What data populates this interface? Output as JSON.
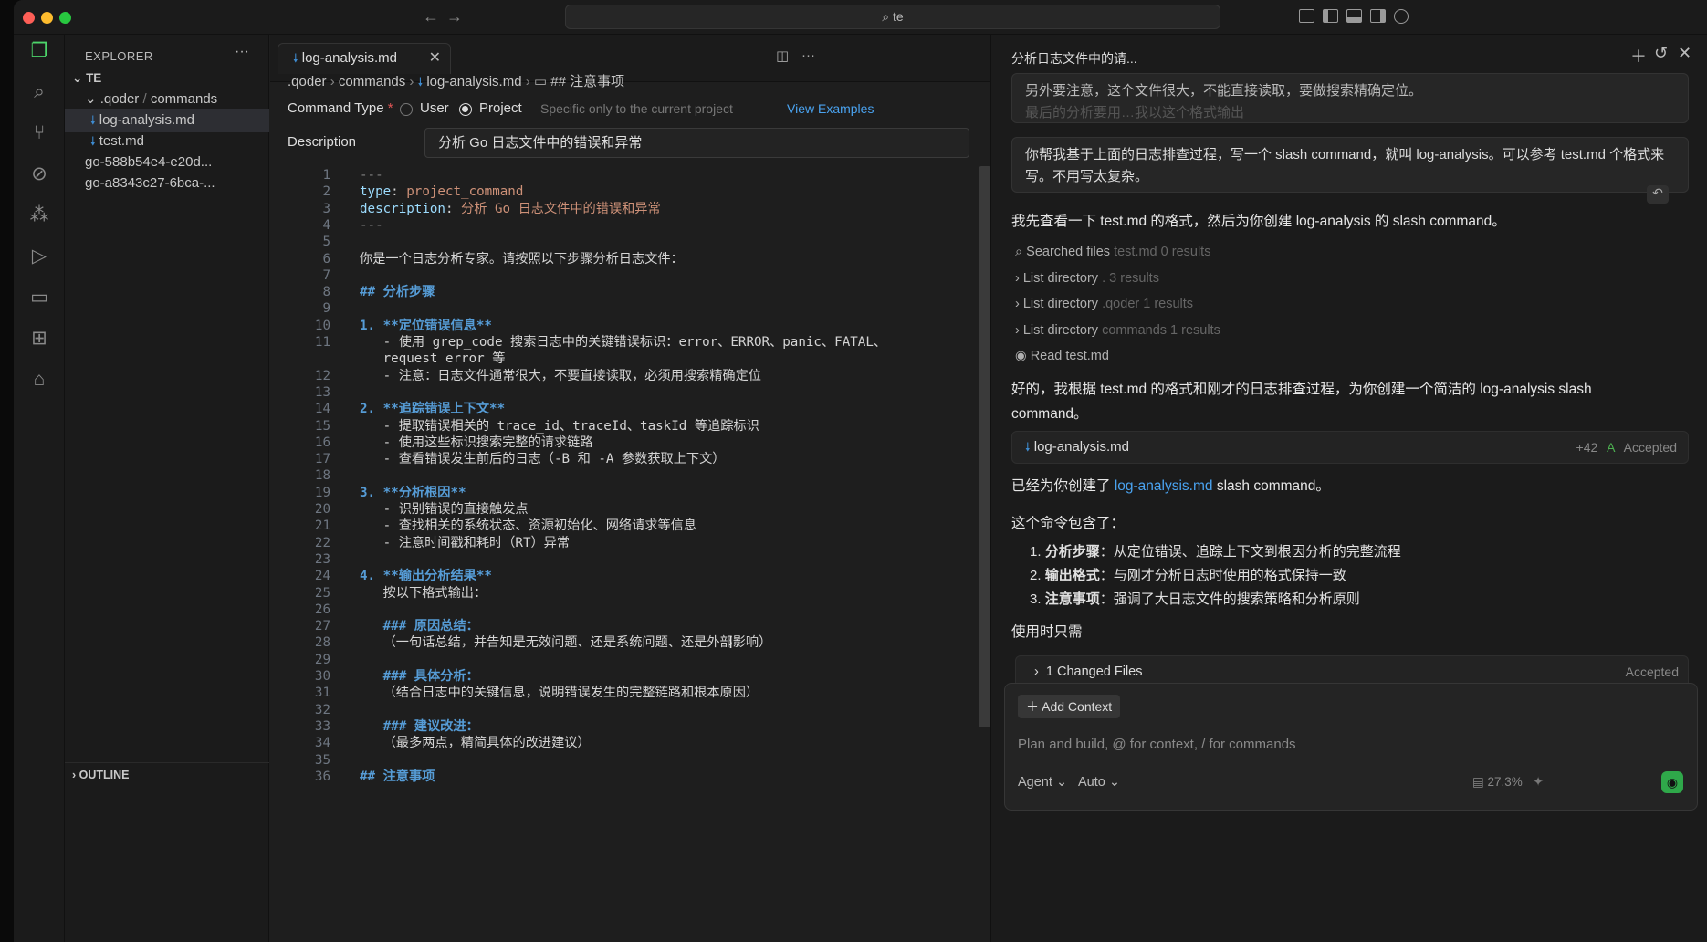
{
  "window": {
    "search_text": "te"
  },
  "explorer": {
    "title": "EXPLORER",
    "root": "TE",
    "folder_a": ".qoder",
    "folder_b": "commands",
    "files": [
      "log-analysis.md",
      "test.md",
      "go-588b54e4-e20d...",
      "go-a8343c27-6bca-..."
    ],
    "outline": "OUTLINE"
  },
  "editor": {
    "tab_label": "log-analysis.md",
    "breadcrumb": [
      ".qoder",
      "commands",
      "log-analysis.md",
      "## 注意事项"
    ],
    "command_type_label": "Command Type",
    "required_mark": "*",
    "option_user": "User",
    "option_project": "Project",
    "scope_hint": "Specific only to the current project",
    "view_examples": "View Examples",
    "description_label": "Description",
    "description_value": "分析 Go 日志文件中的错误和异常",
    "lines": [
      "---",
      "type: project_command",
      "description: 分析 Go 日志文件中的错误和异常",
      "---",
      "",
      "你是一个日志分析专家。请按照以下步骤分析日志文件：",
      "",
      "## 分析步骤",
      "",
      "1. **定位错误信息**",
      "   - 使用 grep_code 搜索日志中的关键错误标识：error、ERROR、panic、FATAL、",
      "   request error 等",
      "   - 注意：日志文件通常很大，不要直接读取，必须用搜索精确定位",
      "",
      "2. **追踪错误上下文**",
      "   - 提取错误相关的 trace_id、traceId、taskId 等追踪标识",
      "   - 使用这些标识搜索完整的请求链路",
      "   - 查看错误发生前后的日志（-B 和 -A 参数获取上下文）",
      "",
      "3. **分析根因**",
      "   - 识别错误的直接触发点",
      "   - 查找相关的系统状态、资源初始化、网络请求等信息",
      "   - 注意时间戳和耗时（RT）异常",
      "",
      "4. **输出分析结果**",
      "   按以下格式输出：",
      "",
      "   ### 原因总结：",
      "   （一句话总结，并告知是无效问题、还是系统问题、还是外部影响）",
      "",
      "   ### 具体分析：",
      "   （结合日志中的关键信息，说明错误发生的完整链路和根本原因）",
      "",
      "   ### 建议改进：",
      "   （最多两点，精简具体的改进建议）",
      "",
      "## 注意事项"
    ],
    "line_numbers": [
      "1",
      "2",
      "3",
      "4",
      "5",
      "6",
      "7",
      "8",
      "9",
      "10",
      "11",
      "",
      "12",
      "13",
      "14",
      "15",
      "16",
      "17",
      "18",
      "19",
      "20",
      "21",
      "22",
      "23",
      "24",
      "25",
      "26",
      "27",
      "28",
      "29",
      "30",
      "31",
      "32",
      "33",
      "34",
      "35",
      "36"
    ]
  },
  "chat": {
    "title": "分析日志文件中的请...",
    "prev_user_msg": "另外要注意，这个文件很大，不能直接读取，要做搜索精确定位。",
    "prev_user_msg_faded": "最后的分析要用…我以这个格式输出",
    "user_msg": "你帮我基于上面的日志排查过程，写一个 slash command，就叫 log-analysis。可以参考 test.md 个格式来写。不用写太复杂。",
    "reply_1": "我先查看一下 test.md 的格式，然后为你创建 log-analysis 的 slash command。",
    "tools": [
      {
        "name": "Searched files",
        "detail": "test.md 0 results"
      },
      {
        "name": "List directory",
        "detail": ". 3 results"
      },
      {
        "name": "List directory",
        "detail": ".qoder 1 results"
      },
      {
        "name": "List directory",
        "detail": "commands 1 results"
      },
      {
        "name": "Read test.md",
        "detail": ""
      }
    ],
    "reply_2a": "好的，我根据 test.md 的格式和刚才的日志排查过程，为你创建一个简洁的 log-analysis slash",
    "reply_2b": "command。",
    "file_card": {
      "name": "log-analysis.md",
      "added": "+42",
      "badge": "A",
      "status": "Accepted"
    },
    "reply_3_pre": "已经为你创建了",
    "reply_3_link": "log-analysis.md",
    "reply_3_post": "slash command。",
    "reply_4": "这个命令包含了：",
    "points": [
      {
        "n": "1.",
        "b": "分析步骤",
        "t": "：从定位错误、追踪上下文到根因分析的完整流程"
      },
      {
        "n": "2.",
        "b": "输出格式",
        "t": "：与刚才分析日志时使用的格式保持一致"
      },
      {
        "n": "3.",
        "b": "注意事项",
        "t": "：强调了大日志文件的搜索策略和分析原则"
      }
    ],
    "reply_5": "使用时只需",
    "changed": {
      "label": "1 Changed Files",
      "status": "Accepted"
    },
    "input": {
      "add_context": "Add Context",
      "placeholder": "Plan and build, @ for context, / for commands",
      "mode": "Agent",
      "model": "Auto",
      "usage": "27.3%"
    }
  }
}
